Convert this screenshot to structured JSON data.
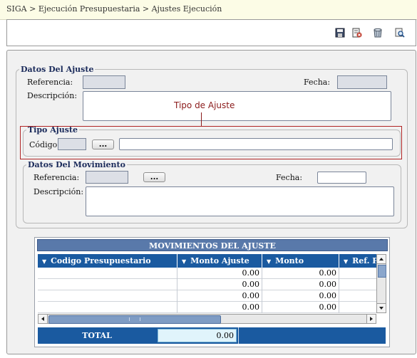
{
  "breadcrumb": "SIGA > Ejecución Presupuestaria > Ajustes Ejecución",
  "toolbar": {
    "icons": [
      "save-icon",
      "delete-icon",
      "trash-icon",
      "search-icon"
    ]
  },
  "datos_ajuste": {
    "legend": "Datos Del Ajuste",
    "referencia_label": "Referencia:",
    "referencia_value": "",
    "fecha_label": "Fecha:",
    "fecha_value": "",
    "descripcion_label": "Descripción:",
    "descripcion_value": ""
  },
  "callout": "Tipo de Ajuste",
  "tipo_ajuste": {
    "legend": "Tipo Ajuste",
    "codigo_label": "Código",
    "codigo_value": "",
    "lookup_label": "...",
    "nombre_value": ""
  },
  "datos_movimiento": {
    "legend": "Datos Del Movimiento",
    "referencia_label": "Referencia:",
    "referencia_value": "",
    "lookup_label": "...",
    "fecha_label": "Fecha:",
    "fecha_value": "",
    "descripcion_label": "Descripción:",
    "descripcion_value": ""
  },
  "grid": {
    "title": "MOVIMIENTOS DEL AJUSTE",
    "columns": [
      "Codigo Presupuestario",
      "Monto Ajuste",
      "Monto",
      "Ref. P"
    ],
    "rows": [
      {
        "codigo": "",
        "monto_ajuste": "0.00",
        "monto": "0.00",
        "ref": ""
      },
      {
        "codigo": "",
        "monto_ajuste": "0.00",
        "monto": "0.00",
        "ref": ""
      },
      {
        "codigo": "",
        "monto_ajuste": "0.00",
        "monto": "0.00",
        "ref": ""
      },
      {
        "codigo": "",
        "monto_ajuste": "0.00",
        "monto": "0.00",
        "ref": ""
      }
    ],
    "total_label": "TOTAL",
    "total_value": "0.00"
  },
  "colors": {
    "header_blue": "#1a5aa0",
    "title_blue": "#5979aa",
    "legend_text": "#1a2a5a",
    "highlight_red": "#b02424",
    "breadcrumb_bg": "#fcfce6"
  }
}
